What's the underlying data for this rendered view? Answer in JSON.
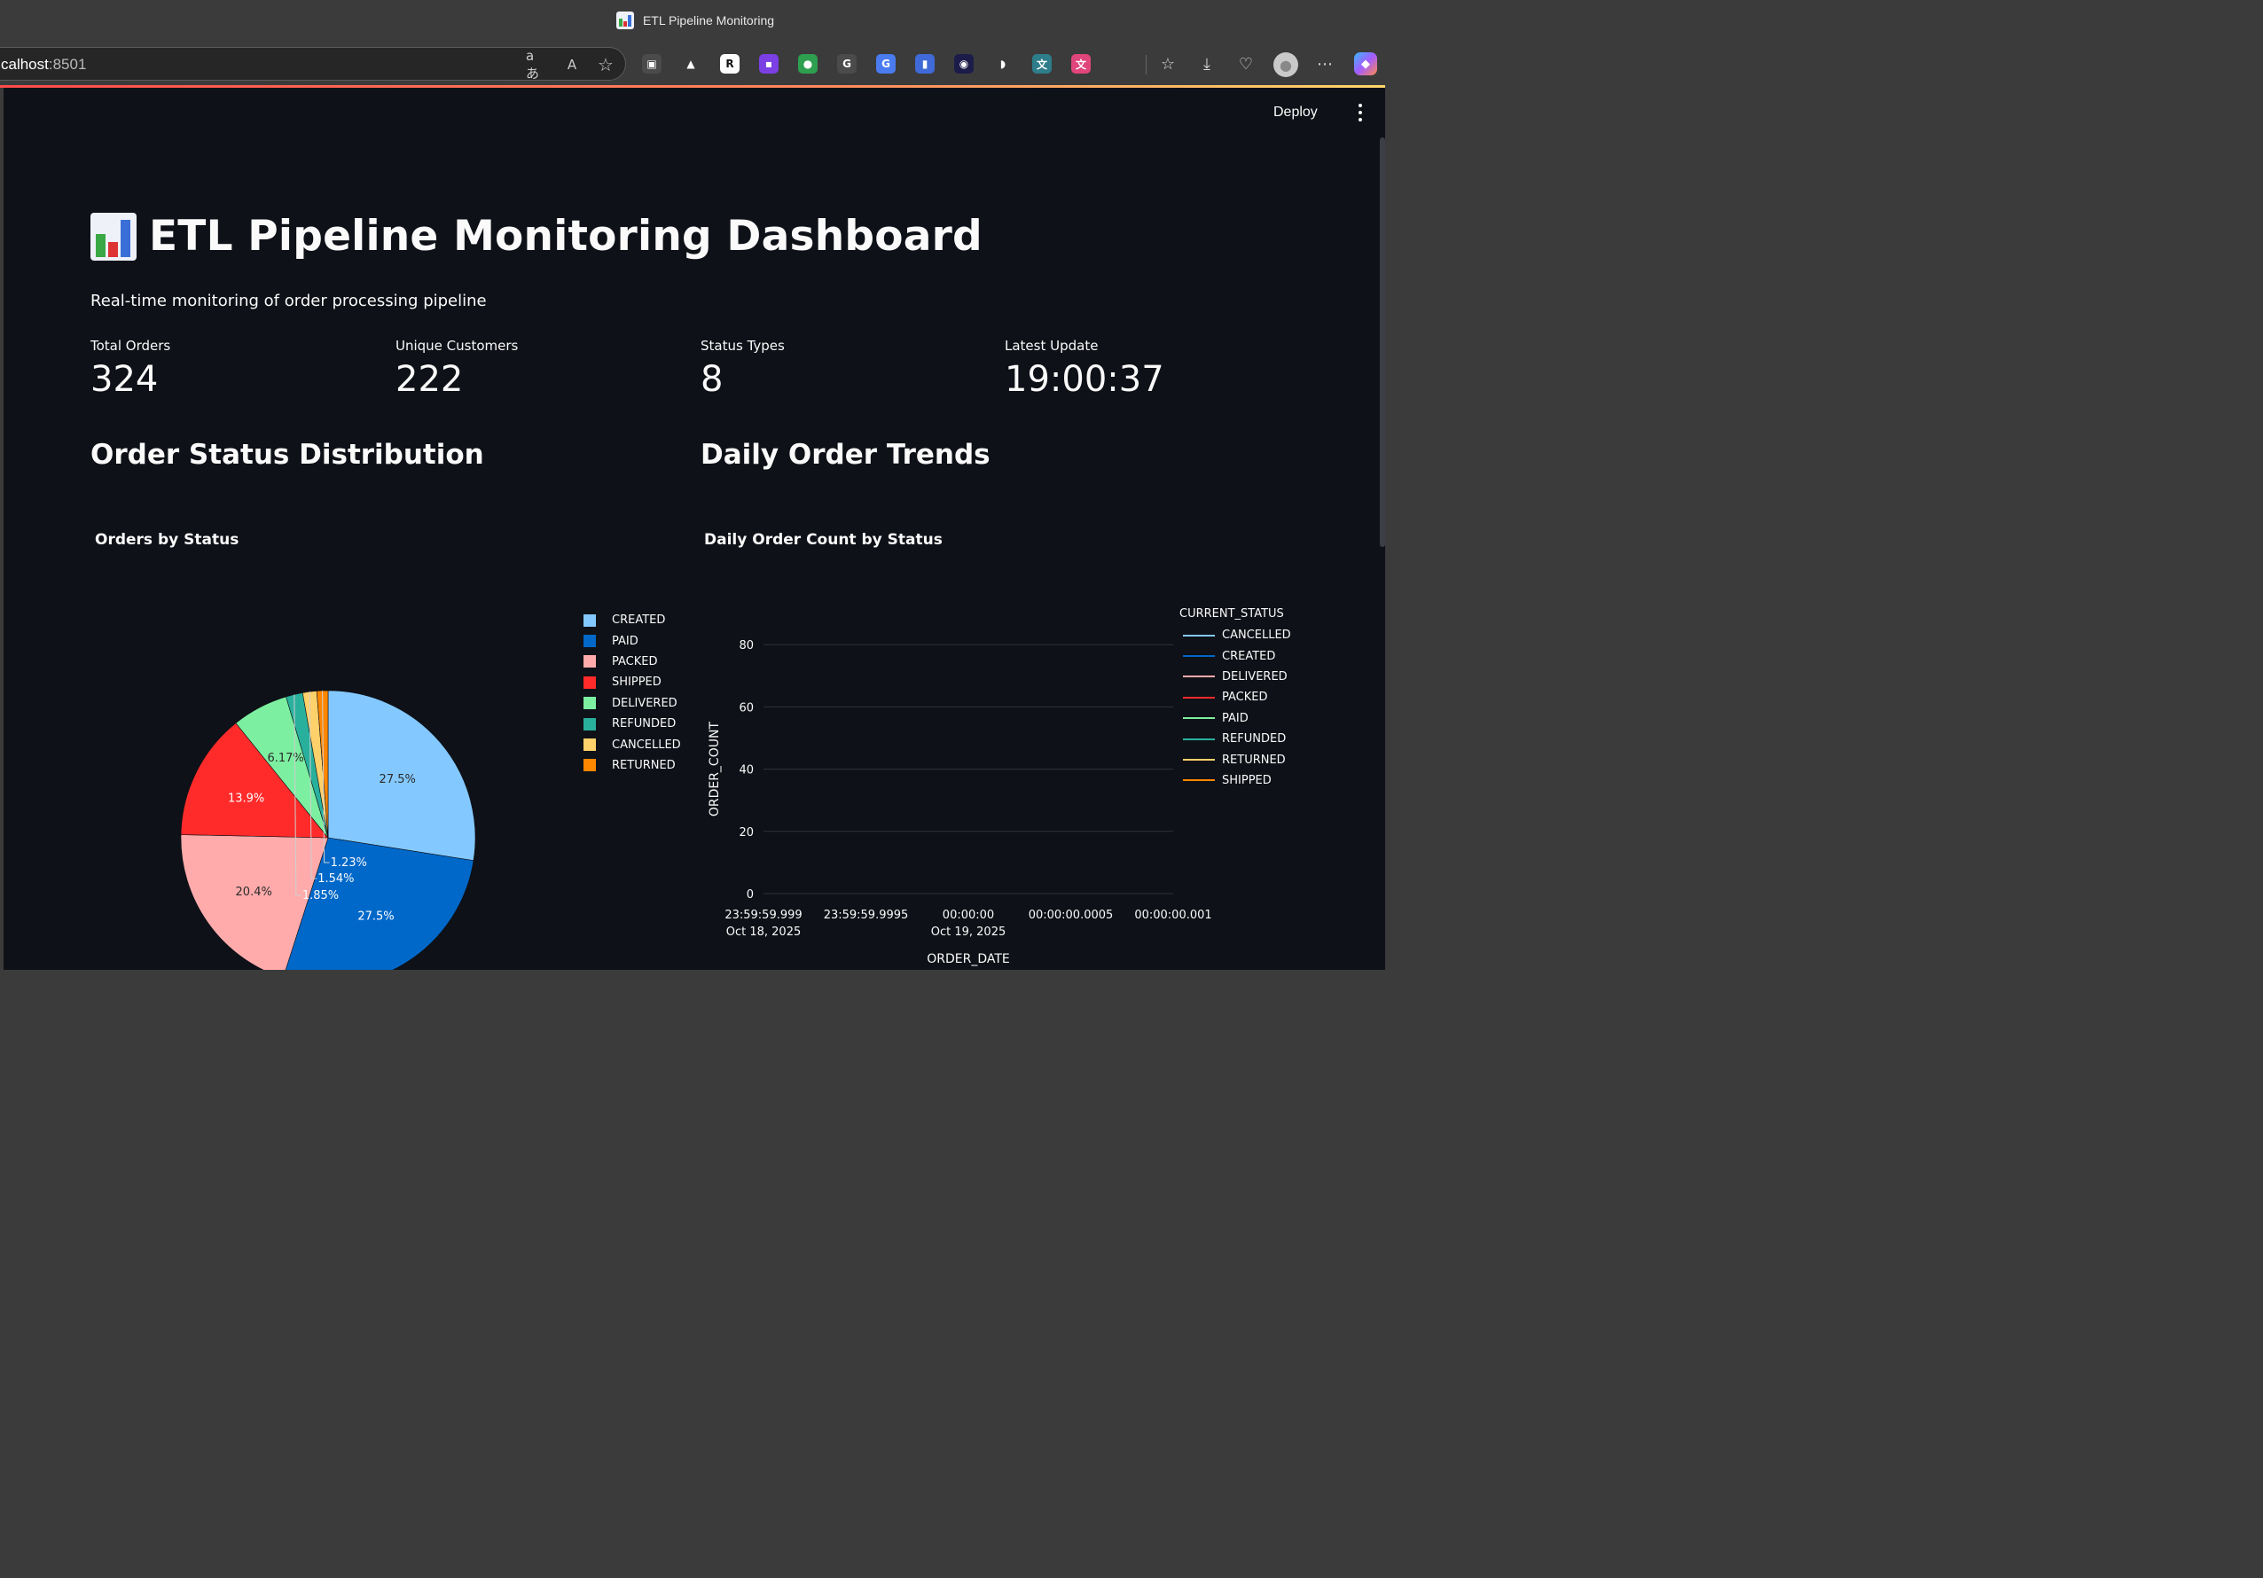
{
  "browser": {
    "tab_title": "ETL Pipeline Monitoring",
    "url_host": "calhost",
    "url_port": ":8501",
    "extensions": [
      {
        "name": "copy-icon",
        "color": "#4b4b4b",
        "glyph": "▣"
      },
      {
        "name": "google-drive-icon",
        "color": "#3b3b3b",
        "glyph": "▲"
      },
      {
        "name": "r-extension-icon",
        "color": "#ffffff",
        "glyph": "R"
      },
      {
        "name": "purple-extension-icon",
        "color": "#7b3fe4",
        "glyph": "▪"
      },
      {
        "name": "robot-extension-icon",
        "color": "#2e9e4f",
        "glyph": "●"
      },
      {
        "name": "grammarly-icon",
        "color": "#4b4b4b",
        "glyph": "G"
      },
      {
        "name": "google-translate-icon",
        "color": "#4a7cf0",
        "glyph": "G"
      },
      {
        "name": "blue-extension-icon",
        "color": "#3f6ad8",
        "glyph": "▮"
      },
      {
        "name": "colorful-extension-icon",
        "color": "#1c1c4a",
        "glyph": "◉"
      },
      {
        "name": "blue-swoosh-icon",
        "color": "#3b3b3b",
        "glyph": "◗"
      },
      {
        "name": "translate-extension-icon",
        "color": "#2d7d8a",
        "glyph": "文"
      },
      {
        "name": "pink-translate-icon",
        "color": "#e0457b",
        "glyph": "文"
      }
    ]
  },
  "app": {
    "deploy_label": "Deploy",
    "title": "ETL Pipeline Monitoring Dashboard",
    "subtitle": "Real-time monitoring of order processing pipeline",
    "metrics": [
      {
        "label": "Total Orders",
        "value": "324"
      },
      {
        "label": "Unique Customers",
        "value": "222"
      },
      {
        "label": "Status Types",
        "value": "8"
      },
      {
        "label": "Latest Update",
        "value": "19:00:37"
      }
    ],
    "sections": {
      "left": "Order Status Distribution",
      "right": "Daily Order Trends"
    }
  },
  "chart_data": [
    {
      "type": "pie",
      "title": "Orders by Status",
      "labels": [
        "CREATED",
        "PAID",
        "PACKED",
        "SHIPPED",
        "DELIVERED",
        "REFUNDED",
        "CANCELLED",
        "RETURNED"
      ],
      "values": [
        27.5,
        27.5,
        20.4,
        13.9,
        6.17,
        1.85,
        1.54,
        1.23
      ],
      "value_labels": [
        "27.5%",
        "27.5%",
        "20.4%",
        "13.9%",
        "6.17%",
        "1.85%",
        "1.54%",
        "1.23%"
      ],
      "colors": [
        "#83c9ff",
        "#0068c9",
        "#ffabab",
        "#ff2b2b",
        "#7defa1",
        "#29b09d",
        "#ffd16a",
        "#ff8700"
      ],
      "legend": "right"
    },
    {
      "type": "line",
      "title": "Daily Order Count by Status",
      "xlabel": "ORDER_DATE",
      "ylabel": "ORDER_COUNT",
      "ylim": [
        0,
        88
      ],
      "yticks": [
        "0",
        "20",
        "40",
        "60",
        "80"
      ],
      "xticks": [
        [
          "23:59:59.999",
          "Oct 18, 2025"
        ],
        [
          "23:59:59.9995",
          ""
        ],
        [
          "00:00:00",
          "Oct 19, 2025"
        ],
        [
          "00:00:00.0005",
          ""
        ],
        [
          "00:00:00.001",
          ""
        ]
      ],
      "grid": true,
      "legend_title": "CURRENT_STATUS",
      "legend": "top-right",
      "series": [
        {
          "name": "CANCELLED",
          "color": "#83c9ff",
          "values": []
        },
        {
          "name": "CREATED",
          "color": "#0068c9",
          "values": []
        },
        {
          "name": "DELIVERED",
          "color": "#ffabab",
          "values": []
        },
        {
          "name": "PACKED",
          "color": "#ff2b2b",
          "values": []
        },
        {
          "name": "PAID",
          "color": "#7defa1",
          "values": []
        },
        {
          "name": "REFUNDED",
          "color": "#29b09d",
          "values": []
        },
        {
          "name": "RETURNED",
          "color": "#ffd16a",
          "values": []
        },
        {
          "name": "SHIPPED",
          "color": "#ff8700",
          "values": []
        }
      ]
    }
  ]
}
